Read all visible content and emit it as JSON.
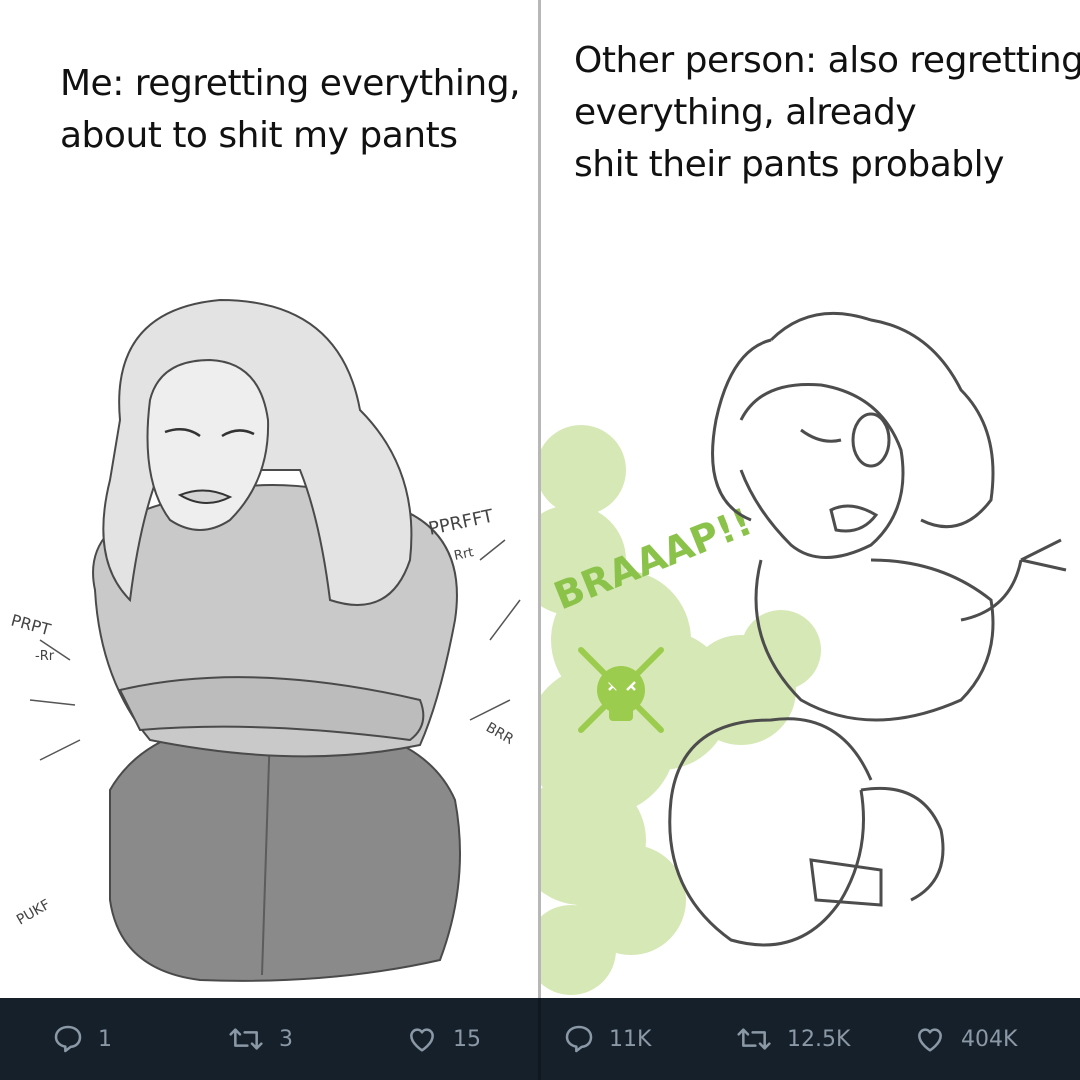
{
  "left_panel": {
    "caption_lines": [
      "Me: regretting everything,",
      "about to shit my pants"
    ],
    "sfx": [
      "PPRFFT",
      "Rrt",
      "PRPT",
      "-Rr",
      "BRR",
      "PUKF"
    ]
  },
  "right_panel": {
    "caption_lines": [
      "Other person: also regretting",
      "everything, already",
      "shit their pants probably"
    ],
    "sfx": [
      "BRAAAP!!"
    ]
  },
  "left_tweet_actions": {
    "replies": "1",
    "retweets": "3",
    "likes": "15"
  },
  "right_tweet_actions": {
    "replies": "11K",
    "retweets": "12.5K",
    "likes": "404K"
  },
  "colors": {
    "footer_bg": "#15202b",
    "action_gray": "#8b98a5",
    "gas_green": "#b5d77a",
    "sfx_green": "#8bc34a"
  }
}
